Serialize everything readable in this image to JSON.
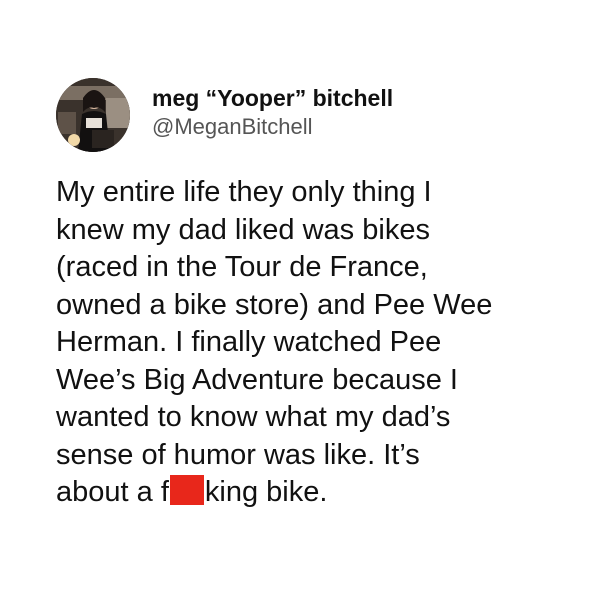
{
  "tweet": {
    "author": {
      "display_name": "meg “Yooper” bitchell",
      "handle": "@MeganBitchell",
      "avatar_icon": "profile-photo-avatar"
    },
    "body_lines": [
      "My entire life they only thing I",
      "knew my dad liked was bikes",
      "(raced in the Tour de France,",
      "owned a bike store) and Pee Wee",
      "Herman. I finally watched Pee",
      "Wee’s Big Adventure because I",
      "wanted to know what my dad’s",
      "sense of humor was like. It’s"
    ],
    "last_line": {
      "before_censor": "about a f",
      "after_censor": "king bike."
    },
    "censor_color": "#e8271b"
  }
}
